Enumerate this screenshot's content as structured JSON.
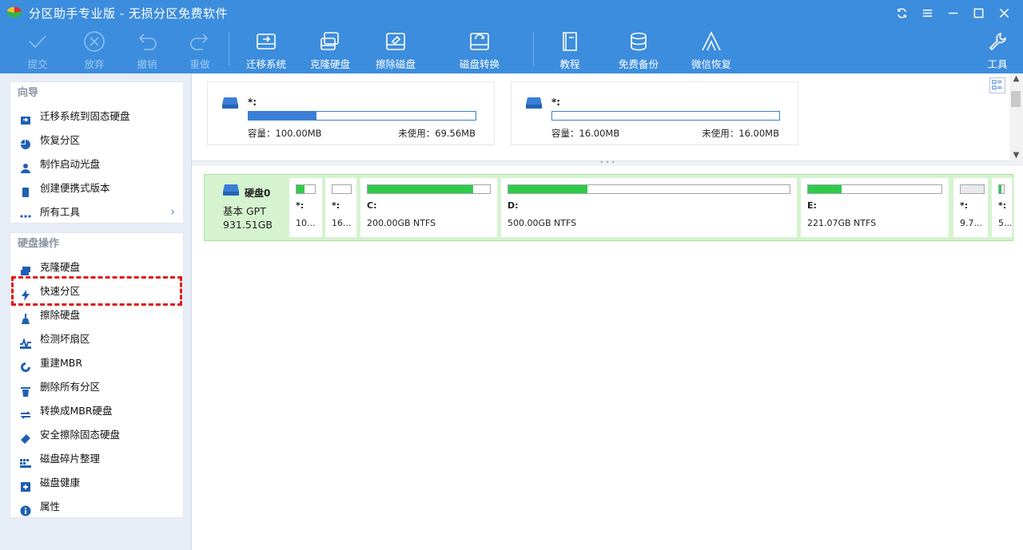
{
  "window": {
    "title": "分区助手专业版 - 无损分区免费软件"
  },
  "toolbar": {
    "commit": "提交",
    "discard": "放弃",
    "undo": "撤销",
    "redo": "重做",
    "migrate_os": "迁移系统",
    "clone_disk": "克隆硬盘",
    "wipe_disk": "擦除磁盘",
    "disk_convert": "磁盘转换",
    "tutorial": "教程",
    "free_backup": "免费备份",
    "wechat_recovery": "微信恢复",
    "tools": "工具"
  },
  "sidebar": {
    "wizard": {
      "title": "向导",
      "items": [
        "迁移系统到固态硬盘",
        "恢复分区",
        "制作启动光盘",
        "创建便携式版本",
        "所有工具"
      ]
    },
    "disk_ops": {
      "title": "硬盘操作",
      "items": [
        "克隆硬盘",
        "快速分区",
        "擦除硬盘",
        "检测坏扇区",
        "重建MBR",
        "删除所有分区",
        "转换成MBR硬盘",
        "安全擦除固态硬盘",
        "磁盘碎片整理",
        "磁盘健康",
        "属性"
      ]
    }
  },
  "volumes": [
    {
      "name": "*:",
      "capacity": "容量：100.00MB",
      "unused": "未使用：69.56MB",
      "used_fraction": 0.3
    },
    {
      "name": "*:",
      "capacity": "容量：16.00MB",
      "unused": "未使用：16.00MB",
      "used_fraction": 0.0
    }
  ],
  "disk": {
    "title": "硬盘0",
    "type": "基本 GPT",
    "size": "931.51GB",
    "partitions": [
      {
        "label": "*:",
        "size": "10...",
        "used_fraction": 0.45
      },
      {
        "label": "*:",
        "size": "16...",
        "used_fraction": 0.0
      },
      {
        "label": "C:",
        "size": "200.00GB NTFS",
        "used_fraction": 0.86
      },
      {
        "label": "D:",
        "size": "500.00GB NTFS",
        "used_fraction": 0.28
      },
      {
        "label": "E:",
        "size": "221.07GB NTFS",
        "used_fraction": 0.25
      },
      {
        "label": "*:",
        "size": "9.7...",
        "used_fraction": 0.0
      },
      {
        "label": "*:",
        "size": "5...",
        "used_fraction": 0.5
      }
    ]
  },
  "colors": {
    "toolbar": "#3c8ddd",
    "used_bar_blue": "#3a7fd5",
    "used_bar_green": "#2ecb4a",
    "disk_row_bg": "#d5f3cf",
    "highlight": "#e01818"
  }
}
